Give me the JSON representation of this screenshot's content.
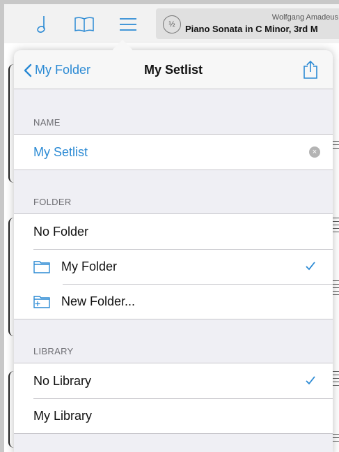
{
  "toolbar": {
    "icons": [
      "music-note-icon",
      "book-icon",
      "menu-icon"
    ],
    "half_badge": "½",
    "composer": "Wolfgang Amadeus",
    "piece_title": "Piano Sonata in C Minor, 3rd M"
  },
  "popover": {
    "back_label": "My Folder",
    "title": "My Setlist",
    "share_icon": "share-icon"
  },
  "name_section": {
    "header": "NAME",
    "value": "My Setlist"
  },
  "folder_section": {
    "header": "FOLDER",
    "items": [
      {
        "label": "No Folder",
        "icon": "",
        "checked": false
      },
      {
        "label": "My Folder",
        "icon": "folder-icon",
        "checked": true
      },
      {
        "label": "New Folder...",
        "icon": "new-folder-icon",
        "checked": false
      }
    ]
  },
  "library_section": {
    "header": "LIBRARY",
    "items": [
      {
        "label": "No Library",
        "checked": true
      },
      {
        "label": "My Library",
        "checked": false
      }
    ]
  },
  "colors": {
    "accent": "#2b8ad4",
    "separator": "#c8c7cc",
    "group_bg": "#efeff4"
  }
}
